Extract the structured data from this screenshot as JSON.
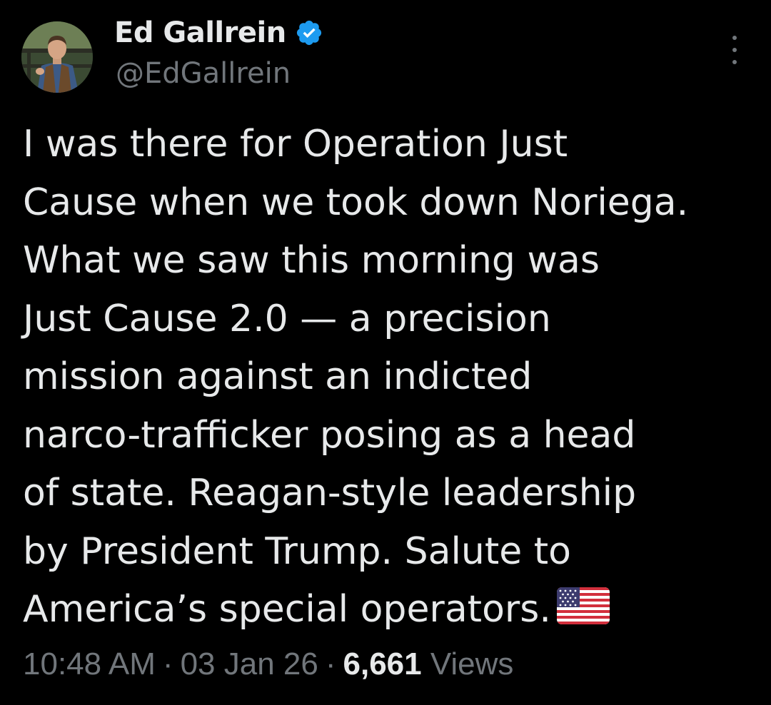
{
  "author": {
    "display_name": "Ed Gallrein",
    "handle": "@EdGallrein",
    "verified": true,
    "verified_icon": "verified-badge-icon",
    "verified_color": "#1d9bf0"
  },
  "tweet": {
    "lines": [
      "I was there for Operation Just",
      "Cause when we took down Noriega.",
      "What we saw this morning was",
      "Just Cause 2.0 — a precision",
      "mission against an indicted",
      "narco-trafficker posing as a head",
      "of state. Reagan-style leadership",
      "by President Trump. Salute to",
      "America’s special operators."
    ],
    "trailing_emoji": "us-flag-emoji"
  },
  "meta": {
    "time": "10:48 AM",
    "separator": "·",
    "date": "03 Jan 26",
    "views_count": "6,661",
    "views_label": "Views"
  },
  "colors": {
    "background": "#000000",
    "text": "#e7e9ea",
    "secondary_text": "#71767b",
    "accent": "#1d9bf0"
  },
  "icons": {
    "more": "more-vertical-icon"
  }
}
